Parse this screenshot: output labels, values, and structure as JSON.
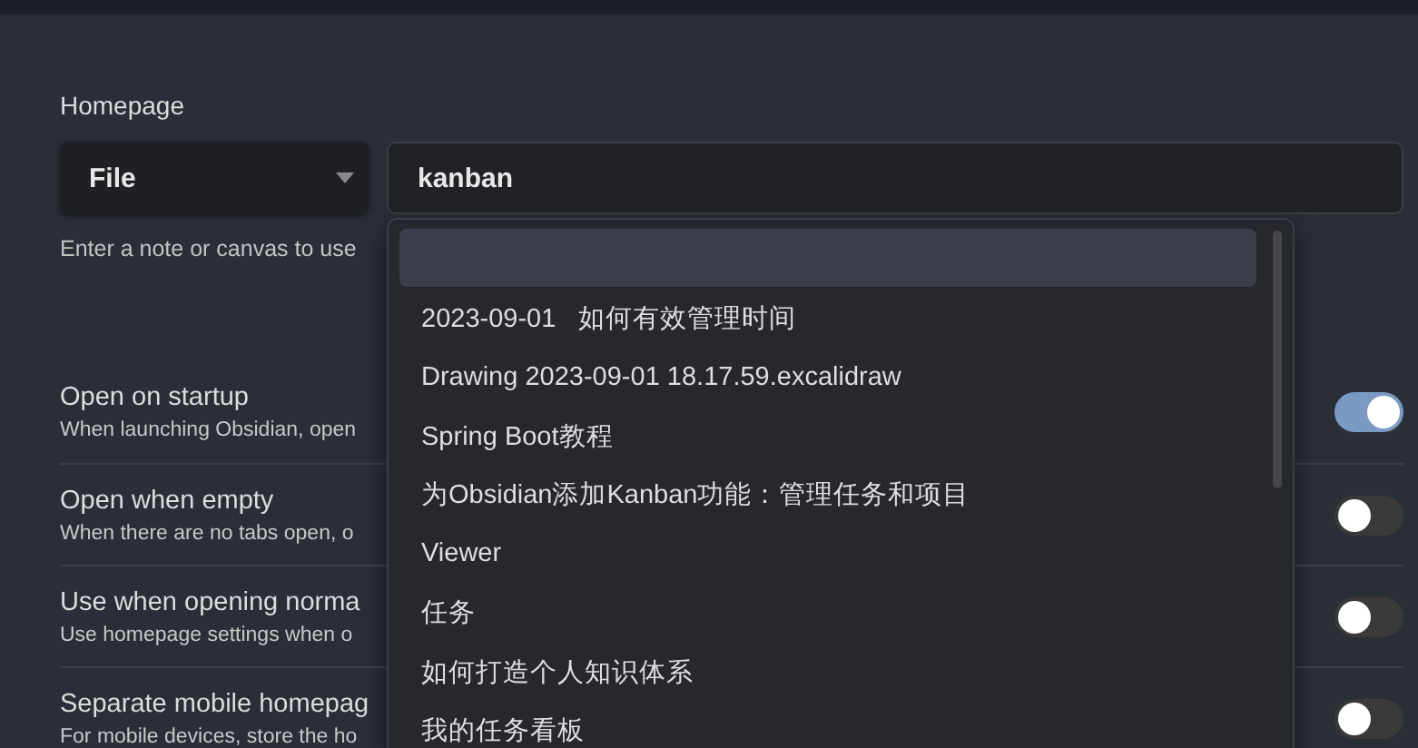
{
  "homepage": {
    "label": "Homepage",
    "type_select": {
      "value": "File"
    },
    "file_field": {
      "value": "kanban"
    },
    "hint": "Enter a note or canvas to use"
  },
  "settings": [
    {
      "title": "Open on startup",
      "description": "When launching Obsidian, open",
      "on": true
    },
    {
      "title": "Open when empty",
      "description": "When there are no tabs open, o",
      "on": false
    },
    {
      "title": "Use when opening norma",
      "description": "Use homepage settings when o",
      "on": false
    },
    {
      "title": "Separate mobile homepag",
      "description": "For mobile devices, store the ho",
      "on": false
    }
  ],
  "suggestions": [
    {
      "selected": true
    },
    {
      "label": "2023-09-01   如何有效管理时间",
      "selected": false
    },
    {
      "label": "Drawing 2023-09-01 18.17.59.excalidraw",
      "selected": false
    },
    {
      "label": "Spring Boot教程",
      "selected": false
    },
    {
      "label": "为Obsidian添加Kanban功能：管理任务和项目",
      "selected": false
    },
    {
      "label": "Viewer",
      "selected": false
    },
    {
      "label": "任务",
      "selected": false
    },
    {
      "label": "如何打造个人知识体系",
      "selected": false
    },
    {
      "label": "我的任务看板",
      "selected": false
    }
  ]
}
